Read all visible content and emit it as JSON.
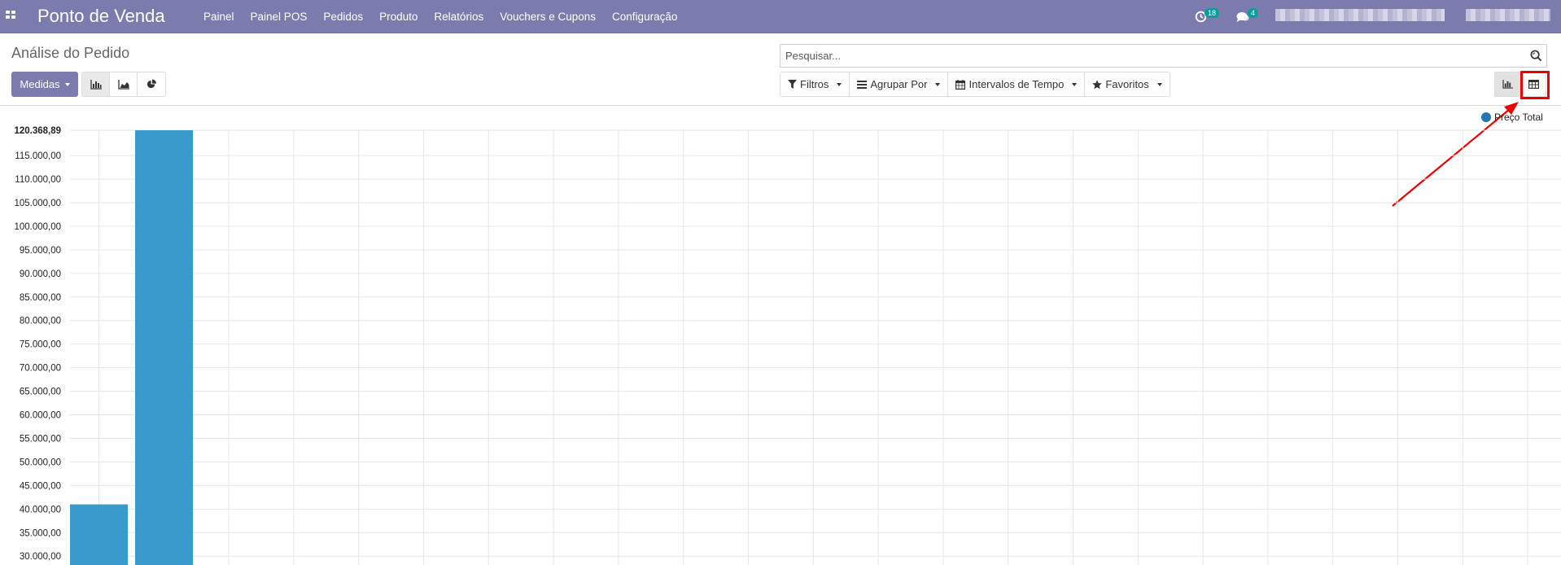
{
  "navbar": {
    "brand": "Ponto de Venda",
    "menu": [
      "Painel",
      "Painel POS",
      "Pedidos",
      "Produto",
      "Relatórios",
      "Vouchers e Cupons",
      "Configuração"
    ],
    "activities_count": "18",
    "messages_count": "4",
    "icons": {
      "apps": "apps-grid-icon",
      "activities": "clock-icon",
      "messages": "chat-icon"
    }
  },
  "control": {
    "title": "Análise do Pedido",
    "measures_label": "Medidas",
    "search_placeholder": "Pesquisar...",
    "filters": {
      "filters_label": "Filtros",
      "group_by_label": "Agrupar Por",
      "time_ranges_label": "Intervalos de Tempo",
      "favorites_label": "Favoritos"
    }
  },
  "colors": {
    "navbar": "#7c7bad",
    "bar": "#3a9ac9",
    "highlight": "#e00000",
    "badge": "#00a09d"
  },
  "chart_data": {
    "type": "bar",
    "series": [
      {
        "name": "Preço Total",
        "values": [
          41000,
          120368.89
        ]
      }
    ],
    "categories": [
      "",
      ""
    ],
    "y_max_label": "120.368,89",
    "y_ticks": [
      "115.000,00",
      "110.000,00",
      "105.000,00",
      "100.000,00",
      "95.000,00",
      "90.000,00",
      "85.000,00",
      "80.000,00",
      "75.000,00",
      "70.000,00",
      "65.000,00",
      "60.000,00",
      "55.000,00",
      "50.000,00",
      "45.000,00",
      "40.000,00",
      "35.000,00",
      "30.000,00"
    ],
    "ylim": [
      30000,
      120368.89
    ],
    "grid": true,
    "legend": "top-right"
  }
}
